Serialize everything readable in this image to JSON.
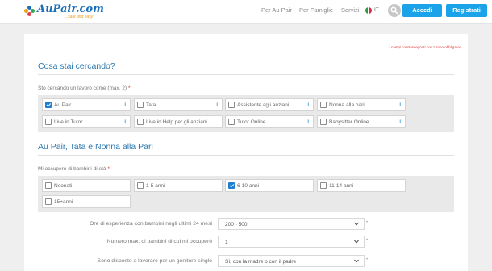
{
  "header": {
    "logo_name": "AuPair.com",
    "logo_tagline": "...safe and easy",
    "nav": [
      "Per Au Pair",
      "Per Famiglie",
      "Servizi"
    ],
    "language": "IT",
    "login_label": "Accedi",
    "register_label": "Registrati"
  },
  "form": {
    "required_note": "I campi contrassegnati con * sono obbligatori",
    "section1_title": "Cosa stai cercando?",
    "job_label": "Sto cercando un lavoro come (max. 2)",
    "jobs": [
      {
        "label": "Au Pair",
        "checked": true
      },
      {
        "label": "Tata",
        "checked": false
      },
      {
        "label": "Assistente agli anziani",
        "checked": false
      },
      {
        "label": "Nonna alla pari",
        "checked": false
      },
      {
        "label": "Live in Tutor",
        "checked": false
      },
      {
        "label": "Live in Help per gli anziani",
        "checked": false
      },
      {
        "label": "Tutor Online",
        "checked": false
      },
      {
        "label": "Babysitter Online",
        "checked": false
      }
    ],
    "section2_title": "Au Pair, Tata e Nonna alla Pari",
    "ages_label": "Mi occuperò di bambini di età",
    "ages": [
      {
        "label": "Neonati",
        "checked": false
      },
      {
        "label": "1-5 anni",
        "checked": false
      },
      {
        "label": "6-10 anni",
        "checked": true
      },
      {
        "label": "11-14 anni",
        "checked": false
      },
      {
        "label": "15+anni",
        "checked": false
      }
    ],
    "experience_label": "Ore di esperienza con bambini negli ultimi 24 mesi",
    "experience_value": "200 - 500",
    "max_children_label": "Numero max. di bambini di cui mi occuperò",
    "max_children_value": "1",
    "single_parent_label": "Sono disposto a lavorare per un genitore single",
    "single_parent_value": "Sì, con la madre o con il padre"
  },
  "colors": {
    "accent": "#1aa3e8",
    "title": "#2a78b0",
    "required": "#d9322a"
  }
}
